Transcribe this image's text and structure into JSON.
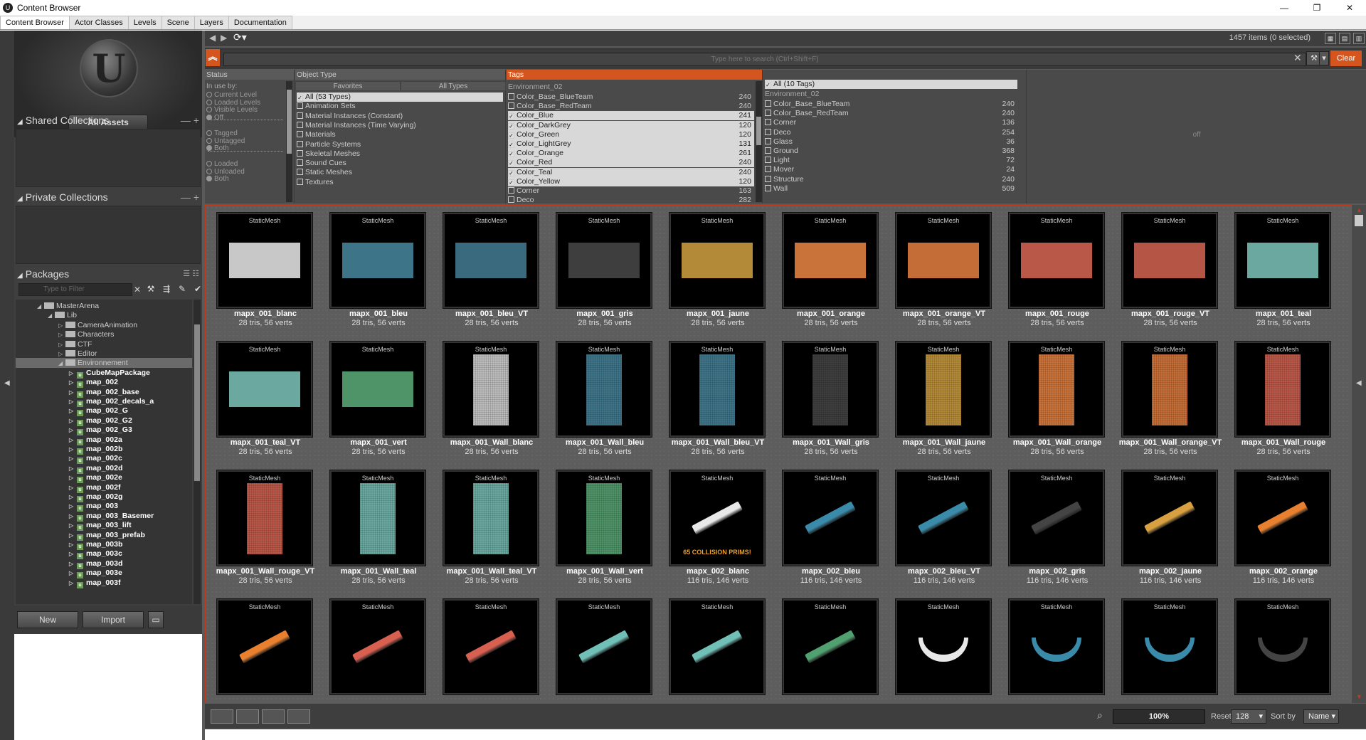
{
  "window": {
    "title": "Content Browser",
    "controls": [
      "—",
      "❐",
      "✕"
    ]
  },
  "tabs": [
    "Content Browser",
    "Actor Classes",
    "Levels",
    "Scene",
    "Layers",
    "Documentation"
  ],
  "left": {
    "logo_glyph": "U",
    "all_assets_label": "All Assets",
    "shared_collections": "Shared Collections",
    "private_collections": "Private Collections",
    "packages": "Packages",
    "filter_placeholder": "Type to Filter",
    "tree": [
      {
        "label": "MasterArena",
        "depth": 0,
        "type": "folder",
        "exp": "◢"
      },
      {
        "label": "Lib",
        "depth": 1,
        "type": "folder",
        "exp": "◢"
      },
      {
        "label": "CameraAnimation",
        "depth": 2,
        "type": "folder",
        "exp": "▷"
      },
      {
        "label": "Characters",
        "depth": 2,
        "type": "folder",
        "exp": "▷"
      },
      {
        "label": "CTF",
        "depth": 2,
        "type": "folder",
        "exp": "▷"
      },
      {
        "label": "Editor",
        "depth": 2,
        "type": "folder",
        "exp": "▷"
      },
      {
        "label": "Environnement",
        "depth": 2,
        "type": "folder",
        "exp": "◢",
        "selected": true
      },
      {
        "label": "CubeMapPackage",
        "depth": 3,
        "type": "pkg",
        "exp": "▷"
      },
      {
        "label": "map_002",
        "depth": 3,
        "type": "pkg",
        "exp": "▷"
      },
      {
        "label": "map_002_base",
        "depth": 3,
        "type": "pkg",
        "exp": "▷"
      },
      {
        "label": "map_002_decals_a",
        "depth": 3,
        "type": "pkg",
        "exp": "▷"
      },
      {
        "label": "map_002_G",
        "depth": 3,
        "type": "pkg",
        "exp": "▷"
      },
      {
        "label": "map_002_G2",
        "depth": 3,
        "type": "pkg",
        "exp": "▷"
      },
      {
        "label": "map_002_G3",
        "depth": 3,
        "type": "pkg",
        "exp": "▷"
      },
      {
        "label": "map_002a",
        "depth": 3,
        "type": "pkg",
        "exp": "▷"
      },
      {
        "label": "map_002b",
        "depth": 3,
        "type": "pkg",
        "exp": "▷"
      },
      {
        "label": "map_002c",
        "depth": 3,
        "type": "pkg",
        "exp": "▷"
      },
      {
        "label": "map_002d",
        "depth": 3,
        "type": "pkg",
        "exp": "▷"
      },
      {
        "label": "map_002e",
        "depth": 3,
        "type": "pkg",
        "exp": "▷"
      },
      {
        "label": "map_002f",
        "depth": 3,
        "type": "pkg",
        "exp": "▷"
      },
      {
        "label": "map_002g",
        "depth": 3,
        "type": "pkg",
        "exp": "▷"
      },
      {
        "label": "map_003",
        "depth": 3,
        "type": "pkg",
        "exp": "▷"
      },
      {
        "label": "map_003_Basemer",
        "depth": 3,
        "type": "pkg",
        "exp": "▷"
      },
      {
        "label": "map_003_lift",
        "depth": 3,
        "type": "pkg",
        "exp": "▷"
      },
      {
        "label": "map_003_prefab",
        "depth": 3,
        "type": "pkg",
        "exp": "▷"
      },
      {
        "label": "map_003b",
        "depth": 3,
        "type": "pkg",
        "exp": "▷"
      },
      {
        "label": "map_003c",
        "depth": 3,
        "type": "pkg",
        "exp": "▷"
      },
      {
        "label": "map_003d",
        "depth": 3,
        "type": "pkg",
        "exp": "▷"
      },
      {
        "label": "map_003e",
        "depth": 3,
        "type": "pkg",
        "exp": "▷"
      },
      {
        "label": "map_003f",
        "depth": 3,
        "type": "pkg",
        "exp": "▷"
      }
    ],
    "new_label": "New",
    "import_label": "Import"
  },
  "toolbar": {
    "item_count": "1457 items (0 selected)",
    "search_placeholder": "Type here to search (Ctrl+Shift+F)",
    "clear_label": "Clear"
  },
  "filters": {
    "status": {
      "header": "Status",
      "in_use_by": "In use by:",
      "group1": [
        {
          "label": "Current Level",
          "on": false
        },
        {
          "label": "Loaded Levels",
          "on": false
        },
        {
          "label": "Visible Levels",
          "on": false
        },
        {
          "label": "Off",
          "on": true
        }
      ],
      "group2": [
        {
          "label": "Tagged",
          "on": false
        },
        {
          "label": "Untagged",
          "on": false
        },
        {
          "label": "Both",
          "on": true
        }
      ],
      "group3": [
        {
          "label": "Loaded",
          "on": false
        },
        {
          "label": "Unloaded",
          "on": false
        },
        {
          "label": "Both",
          "on": true
        }
      ]
    },
    "object_type": {
      "header": "Object Type",
      "favorites_tab": "Favorites",
      "all_types_tab": "All Types",
      "items": [
        {
          "label": "All (53 Types)",
          "on": true,
          "hl": true
        },
        {
          "label": "Animation Sets",
          "on": false
        },
        {
          "label": "Material Instances (Constant)",
          "on": false
        },
        {
          "label": "Material Instances (Time Varying)",
          "on": false
        },
        {
          "label": "Materials",
          "on": false
        },
        {
          "label": "Particle Systems",
          "on": false
        },
        {
          "label": "Skeletal Meshes",
          "on": false
        },
        {
          "label": "Sound Cues",
          "on": false
        },
        {
          "label": "Static Meshes",
          "on": false
        },
        {
          "label": "Textures",
          "on": false
        }
      ]
    },
    "tags": {
      "header": "Tags",
      "group": "Environment_02",
      "items": [
        {
          "label": "Color_Base_BlueTeam",
          "n": "240",
          "on": false,
          "hl": false
        },
        {
          "label": "Color_Base_RedTeam",
          "n": "240",
          "on": false,
          "hl": false
        },
        {
          "label": "Color_Blue",
          "n": "241",
          "on": true,
          "hl": true
        },
        {
          "label": "Color_DarkGrey",
          "n": "120",
          "on": true,
          "hl": true
        },
        {
          "label": "Color_Green",
          "n": "120",
          "on": true,
          "hl": true
        },
        {
          "label": "Color_LightGrey",
          "n": "131",
          "on": true,
          "hl": true
        },
        {
          "label": "Color_Orange",
          "n": "261",
          "on": true,
          "hl": true
        },
        {
          "label": "Color_Red",
          "n": "240",
          "on": true,
          "hl": true
        },
        {
          "label": "Color_Teal",
          "n": "240",
          "on": true,
          "hl": true
        },
        {
          "label": "Color_Yellow",
          "n": "120",
          "on": true,
          "hl": true
        },
        {
          "label": "Corner",
          "n": "163",
          "on": false,
          "hl": false
        },
        {
          "label": "Deco",
          "n": "282",
          "on": false,
          "hl": false
        }
      ]
    },
    "all_tags": {
      "all_label": "All (10 Tags)",
      "group": "Environment_02",
      "items": [
        {
          "label": "Color_Base_BlueTeam",
          "n": "240"
        },
        {
          "label": "Color_Base_RedTeam",
          "n": "240"
        },
        {
          "label": "Corner",
          "n": "136"
        },
        {
          "label": "Deco",
          "n": "254"
        },
        {
          "label": "Glass",
          "n": "36"
        },
        {
          "label": "Ground",
          "n": "368"
        },
        {
          "label": "Light",
          "n": "72"
        },
        {
          "label": "Mover",
          "n": "24"
        },
        {
          "label": "Structure",
          "n": "240"
        },
        {
          "label": "Wall",
          "n": "509"
        }
      ],
      "off_label": "off"
    }
  },
  "assets": [
    {
      "kind": "StaticMesh",
      "name": "mapx_001_blanc",
      "info": "28 tris, 56 verts",
      "shape": "wide",
      "color": "#c8c8c8"
    },
    {
      "kind": "StaticMesh",
      "name": "mapx_001_bleu",
      "info": "28 tris, 56 verts",
      "shape": "wide",
      "color": "#3e7488"
    },
    {
      "kind": "StaticMesh",
      "name": "mapx_001_bleu_VT",
      "info": "28 tris, 56 verts",
      "shape": "wide",
      "color": "#3a6a7e"
    },
    {
      "kind": "StaticMesh",
      "name": "mapx_001_gris",
      "info": "28 tris, 56 verts",
      "shape": "wide",
      "color": "#3e3e3e"
    },
    {
      "kind": "StaticMesh",
      "name": "mapx_001_jaune",
      "info": "28 tris, 56 verts",
      "shape": "wide",
      "color": "#b38a38"
    },
    {
      "kind": "StaticMesh",
      "name": "mapx_001_orange",
      "info": "28 tris, 56 verts",
      "shape": "wide",
      "color": "#c9723a"
    },
    {
      "kind": "StaticMesh",
      "name": "mapx_001_orange_VT",
      "info": "28 tris, 56 verts",
      "shape": "wide",
      "color": "#c56d36"
    },
    {
      "kind": "StaticMesh",
      "name": "mapx_001_rouge",
      "info": "28 tris, 56 verts",
      "shape": "wide",
      "color": "#b95848"
    },
    {
      "kind": "StaticMesh",
      "name": "mapx_001_rouge_VT",
      "info": "28 tris, 56 verts",
      "shape": "wide",
      "color": "#b55545"
    },
    {
      "kind": "StaticMesh",
      "name": "mapx_001_teal",
      "info": "28 tris, 56 verts",
      "shape": "wide",
      "color": "#6aa8a0"
    },
    {
      "kind": "StaticMesh",
      "name": "mapx_001_teal_VT",
      "info": "28 tris, 56 verts",
      "shape": "wide",
      "color": "#6aa8a0"
    },
    {
      "kind": "StaticMesh",
      "name": "mapx_001_vert",
      "info": "28 tris, 56 verts",
      "shape": "wide",
      "color": "#4e9468"
    },
    {
      "kind": "StaticMesh",
      "name": "mapx_001_Wall_blanc",
      "info": "28 tris, 56 verts",
      "shape": "tall",
      "color": "#bcbcbc"
    },
    {
      "kind": "StaticMesh",
      "name": "mapx_001_Wall_bleu",
      "info": "28 tris, 56 verts",
      "shape": "tall",
      "color": "#3e7488"
    },
    {
      "kind": "StaticMesh",
      "name": "mapx_001_Wall_bleu_VT",
      "info": "28 tris, 56 verts",
      "shape": "tall",
      "color": "#3e7488"
    },
    {
      "kind": "StaticMesh",
      "name": "mapx_001_Wall_gris",
      "info": "28 tris, 56 verts",
      "shape": "tall",
      "color": "#3e3e3e"
    },
    {
      "kind": "StaticMesh",
      "name": "mapx_001_Wall_jaune",
      "info": "28 tris, 56 verts",
      "shape": "tall",
      "color": "#b38a38"
    },
    {
      "kind": "StaticMesh",
      "name": "mapx_001_Wall_orange",
      "info": "28 tris, 56 verts",
      "shape": "tall",
      "color": "#c9723a"
    },
    {
      "kind": "StaticMesh",
      "name": "mapx_001_Wall_orange_VT",
      "info": "28 tris, 56 verts",
      "shape": "tall",
      "color": "#c56d36"
    },
    {
      "kind": "StaticMesh",
      "name": "mapx_001_Wall_rouge",
      "info": "28 tris, 56 verts",
      "shape": "tall",
      "color": "#b95848"
    },
    {
      "kind": "StaticMesh",
      "name": "mapx_001_Wall_rouge_VT",
      "info": "28 tris, 56 verts",
      "shape": "tall",
      "color": "#b95848"
    },
    {
      "kind": "StaticMesh",
      "name": "mapx_001_Wall_teal",
      "info": "28 tris, 56 verts",
      "shape": "tall",
      "color": "#6aa8a0"
    },
    {
      "kind": "StaticMesh",
      "name": "mapx_001_Wall_teal_VT",
      "info": "28 tris, 56 verts",
      "shape": "tall",
      "color": "#6aa8a0"
    },
    {
      "kind": "StaticMesh",
      "name": "mapx_001_Wall_vert",
      "info": "28 tris, 56 verts",
      "shape": "tall",
      "color": "#4e9468"
    },
    {
      "kind": "StaticMesh",
      "name": "mapx_002_blanc",
      "info": "116 tris, 146 verts",
      "shape": "beam",
      "color": "#e8e8e8",
      "note": "65 COLLISION PRIMS!"
    },
    {
      "kind": "StaticMesh",
      "name": "mapx_002_bleu",
      "info": "116 tris, 146 verts",
      "shape": "beam",
      "color": "#3a8aaa"
    },
    {
      "kind": "StaticMesh",
      "name": "mapx_002_bleu_VT",
      "info": "116 tris, 146 verts",
      "shape": "beam",
      "color": "#3a8aaa"
    },
    {
      "kind": "StaticMesh",
      "name": "mapx_002_gris",
      "info": "116 tris, 146 verts",
      "shape": "beam",
      "color": "#444444"
    },
    {
      "kind": "StaticMesh",
      "name": "mapx_002_jaune",
      "info": "116 tris, 146 verts",
      "shape": "beam",
      "color": "#d8a040"
    },
    {
      "kind": "StaticMesh",
      "name": "mapx_002_orange",
      "info": "116 tris, 146 verts",
      "shape": "beam",
      "color": "#e88030"
    },
    {
      "kind": "StaticMesh",
      "name": "",
      "info": "",
      "shape": "beam",
      "color": "#e88030"
    },
    {
      "kind": "StaticMesh",
      "name": "",
      "info": "",
      "shape": "beam",
      "color": "#d86050"
    },
    {
      "kind": "StaticMesh",
      "name": "",
      "info": "",
      "shape": "beam",
      "color": "#d86050"
    },
    {
      "kind": "StaticMesh",
      "name": "",
      "info": "",
      "shape": "beam",
      "color": "#70c0b8"
    },
    {
      "kind": "StaticMesh",
      "name": "",
      "info": "",
      "shape": "beam",
      "color": "#70c0b8"
    },
    {
      "kind": "StaticMesh",
      "name": "",
      "info": "",
      "shape": "beam",
      "color": "#50a070"
    },
    {
      "kind": "StaticMesh",
      "name": "",
      "info": "",
      "shape": "corner",
      "color": "#e8e8e8"
    },
    {
      "kind": "StaticMesh",
      "name": "",
      "info": "",
      "shape": "corner",
      "color": "#3a8aaa"
    },
    {
      "kind": "StaticMesh",
      "name": "",
      "info": "",
      "shape": "corner",
      "color": "#3a8aaa"
    },
    {
      "kind": "StaticMesh",
      "name": "",
      "info": "",
      "shape": "corner",
      "color": "#444444"
    }
  ],
  "bottom": {
    "zoom": "100%",
    "reset_label": "Reset",
    "size_value": "128",
    "sort_by_label": "Sort by",
    "sort_value": "Name"
  }
}
